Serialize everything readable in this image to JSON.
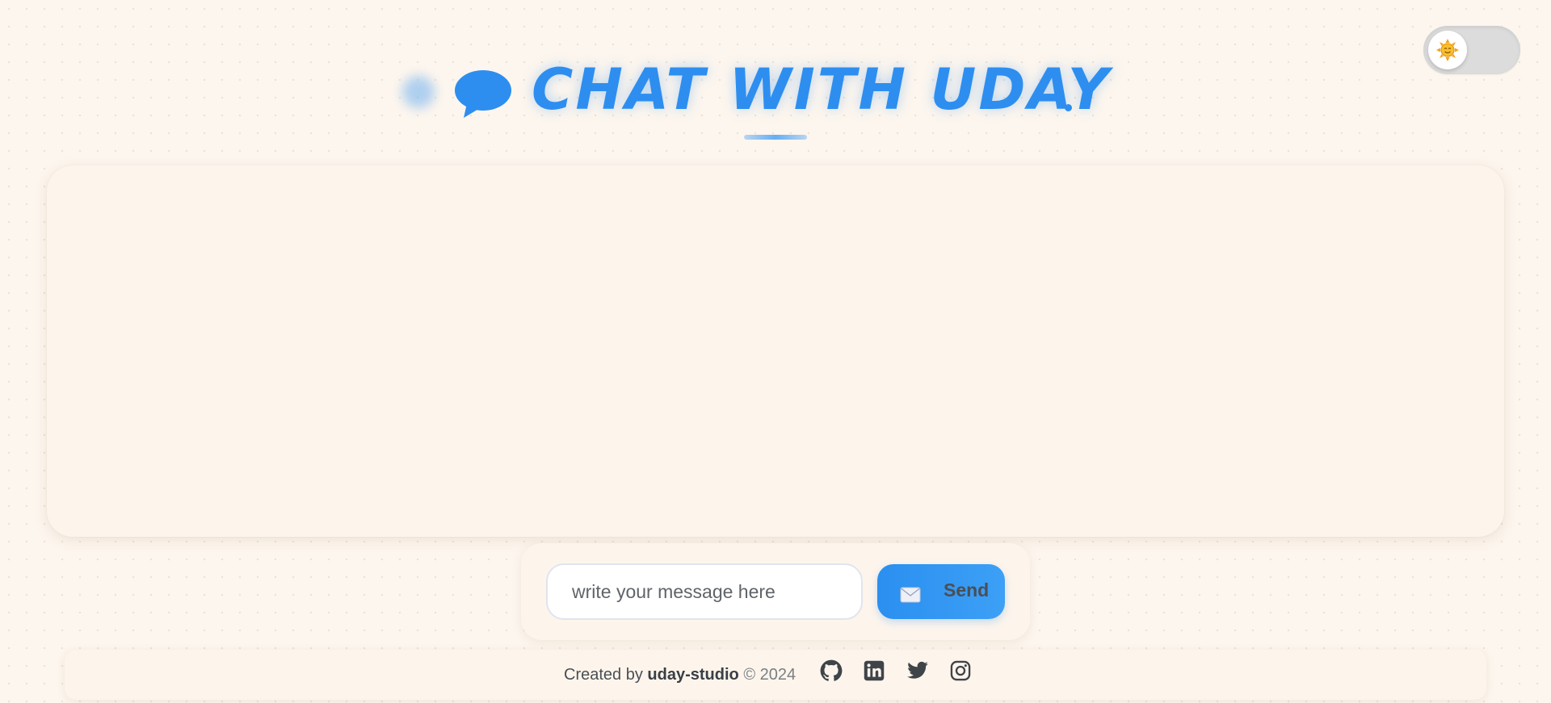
{
  "theme_toggle": {
    "icon": "sun-icon",
    "state": "light"
  },
  "header": {
    "title": "CHAT WITH UDAY",
    "icon": "speech-bubble-icon",
    "accent_color": "#2d8ef0"
  },
  "chat": {
    "messages": []
  },
  "composer": {
    "placeholder": "write your message here",
    "value": "",
    "send_label": "Send",
    "send_icon": "envelope-icon",
    "button_color": "#2a8ff0"
  },
  "footer": {
    "created_by": "Created by",
    "brand": "uday-studio",
    "copyright": "© 2024",
    "social_links": [
      {
        "name": "github-icon"
      },
      {
        "name": "linkedin-icon"
      },
      {
        "name": "twitter-icon"
      },
      {
        "name": "instagram-icon"
      }
    ]
  },
  "colors": {
    "background": "#fdf6ee",
    "panel": "#fdf5ec",
    "toggle_track": "#dcdcdc"
  }
}
